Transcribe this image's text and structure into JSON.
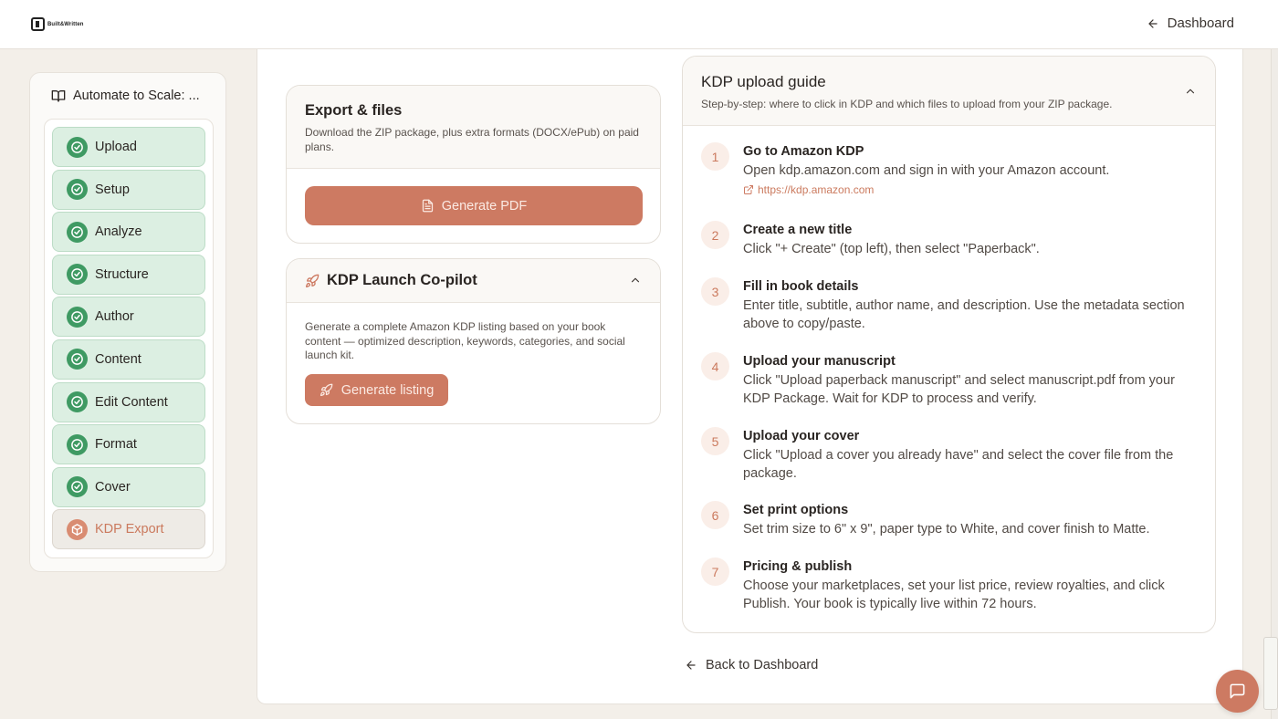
{
  "brand": {
    "logo_text": "Built&Written"
  },
  "nav": {
    "dashboard_label": "Dashboard"
  },
  "sidebar": {
    "title": "Automate to Scale: ...",
    "steps": [
      {
        "label": "Upload",
        "status": "complete"
      },
      {
        "label": "Setup",
        "status": "complete"
      },
      {
        "label": "Analyze",
        "status": "complete"
      },
      {
        "label": "Structure",
        "status": "complete"
      },
      {
        "label": "Author",
        "status": "complete"
      },
      {
        "label": "Content",
        "status": "complete"
      },
      {
        "label": "Edit Content",
        "status": "complete"
      },
      {
        "label": "Format",
        "status": "complete"
      },
      {
        "label": "Cover",
        "status": "complete"
      },
      {
        "label": "KDP Export",
        "status": "current"
      }
    ]
  },
  "export": {
    "title": "Export & files",
    "description": "Download the ZIP package, plus extra formats (DOCX/ePub) on paid plans.",
    "pdf_button": "Generate PDF"
  },
  "launch": {
    "title": "KDP Launch Co-pilot",
    "description": "Generate a complete Amazon KDP listing based on your book content — optimized description, keywords, categories, and social launch kit.",
    "button": "Generate listing"
  },
  "guide": {
    "title": "KDP upload guide",
    "description": "Step-by-step: where to click in KDP and which files to upload from your ZIP package.",
    "steps": [
      {
        "num": "1",
        "title": "Go to Amazon KDP",
        "body": "Open kdp.amazon.com and sign in with your Amazon account.",
        "link": "https://kdp.amazon.com"
      },
      {
        "num": "2",
        "title": "Create a new title",
        "body": "Click \"+ Create\" (top left), then select \"Paperback\"."
      },
      {
        "num": "3",
        "title": "Fill in book details",
        "body": "Enter title, subtitle, author name, and description. Use the metadata section above to copy/paste."
      },
      {
        "num": "4",
        "title": "Upload your manuscript",
        "body": "Click \"Upload paperback manuscript\" and select manuscript.pdf from your KDP Package. Wait for KDP to process and verify."
      },
      {
        "num": "5",
        "title": "Upload your cover",
        "body": "Click \"Upload a cover you already have\" and select the cover file from the package."
      },
      {
        "num": "6",
        "title": "Set print options",
        "body": "Set trim size to 6\" x 9\", paper type to White, and cover finish to Matte."
      },
      {
        "num": "7",
        "title": "Pricing & publish",
        "body": "Choose your marketplaces, set your list price, review royalties, and click Publish. Your book is typically live within 72 hours."
      }
    ]
  },
  "footer": {
    "back_label": "Back to Dashboard"
  },
  "colors": {
    "accent": "#cd7a62",
    "success": "#3f9a63",
    "success_bg": "#dcefe2"
  }
}
